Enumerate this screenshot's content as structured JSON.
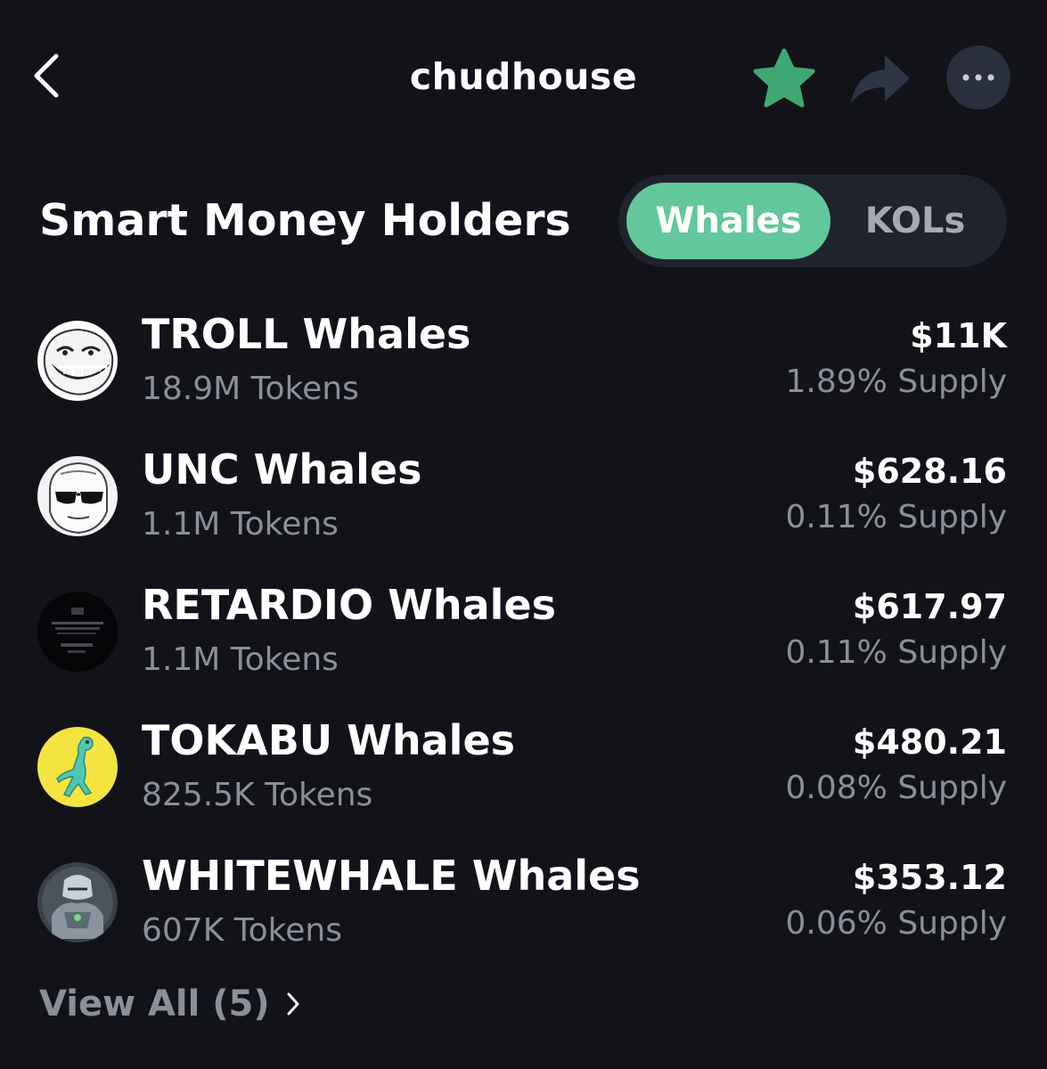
{
  "header": {
    "title": "chudhouse",
    "back_icon": "chevron-left-icon",
    "star_icon": "star-icon",
    "share_icon": "share-arrow-icon",
    "more_icon": "more-horizontal-icon"
  },
  "section": {
    "title": "Smart Money Holders"
  },
  "toggle": {
    "options": [
      "Whales",
      "KOLs"
    ],
    "selected": "Whales"
  },
  "holders": [
    {
      "name": "TROLL Whales",
      "tokens": "18.9M Tokens",
      "value": "$11K",
      "supply": "1.89% Supply",
      "avatar": "troll-face"
    },
    {
      "name": "UNC Whales",
      "tokens": "1.1M Tokens",
      "value": "$628.16",
      "supply": "0.11% Supply",
      "avatar": "unc-face"
    },
    {
      "name": "RETARDIO Whales",
      "tokens": "1.1M Tokens",
      "value": "$617.97",
      "supply": "0.11% Supply",
      "avatar": "retardio-dark"
    },
    {
      "name": "TOKABU Whales",
      "tokens": "825.5K Tokens",
      "value": "$480.21",
      "supply": "0.08% Supply",
      "avatar": "tokabu-lizard"
    },
    {
      "name": "WHITEWHALE Whales",
      "tokens": "607K Tokens",
      "value": "$353.12",
      "supply": "0.06% Supply",
      "avatar": "whitewhale-robot"
    }
  ],
  "footer": {
    "view_all": "View All (5)"
  },
  "colors": {
    "background": "#121318",
    "accent": "#62c79b",
    "secondary_text": "#8b8f99",
    "toggle_bg": "#1f232e",
    "icon_muted": "#2f3646"
  }
}
